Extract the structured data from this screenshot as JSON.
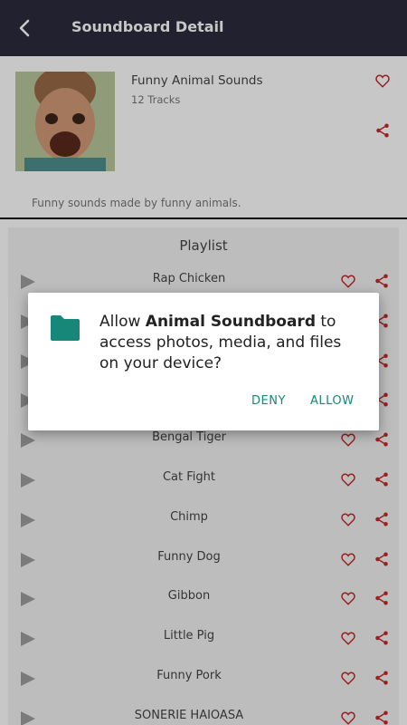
{
  "appbar": {
    "title": "Soundboard Detail"
  },
  "soundboard": {
    "name": "Funny Animal Sounds",
    "tracks": "12 Tracks",
    "description": "Funny sounds made by funny animals."
  },
  "playlist": {
    "title": "Playlist",
    "items": [
      "Rap Chicken",
      "",
      "",
      "",
      "Bengal Tiger",
      "Cat Fight",
      "Chimp",
      "Funny Dog",
      "Gibbon",
      "Little Pig",
      "Funny Pork",
      "SONERIE HAIOASA"
    ]
  },
  "dialog": {
    "prefix": "Allow ",
    "app": "Animal Soundboard",
    "suffix": " to access photos, media, and files on your device?",
    "deny": "DENY",
    "allow": "ALLOW"
  },
  "colors": {
    "accent_red": "#c62828",
    "dialog_teal": "#17877a",
    "appbar": "#2b2b3d"
  }
}
